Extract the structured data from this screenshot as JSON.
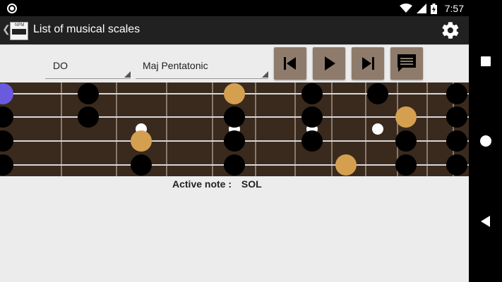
{
  "status_bar": {
    "time": "7:57",
    "icons": [
      "circle-notification-icon",
      "wifi-icon",
      "signal-icon",
      "battery-charging-icon"
    ]
  },
  "app_bar": {
    "title": "List of musical scales",
    "app_icon_text": "NPM",
    "settings_icon": "gear-icon"
  },
  "controls": {
    "root_note": "DO",
    "scale": "Maj Pentatonic",
    "buttons": [
      "skip-previous-icon",
      "play-icon",
      "skip-next-icon",
      "message-icon"
    ]
  },
  "fretboard": {
    "strings": 4,
    "colors": {
      "wood": "#3a2a1e",
      "string": "#d8d8d8",
      "fret": "#8a7a6c",
      "note": "#000000",
      "highlight": "#d4a050",
      "active": "#6a5ae0",
      "inlay": "#ffffff"
    }
  },
  "active_note": {
    "label": "Active note :",
    "value": "SOL"
  },
  "nav_bar": {
    "icons": [
      "recents-icon",
      "home-icon",
      "back-icon"
    ]
  }
}
